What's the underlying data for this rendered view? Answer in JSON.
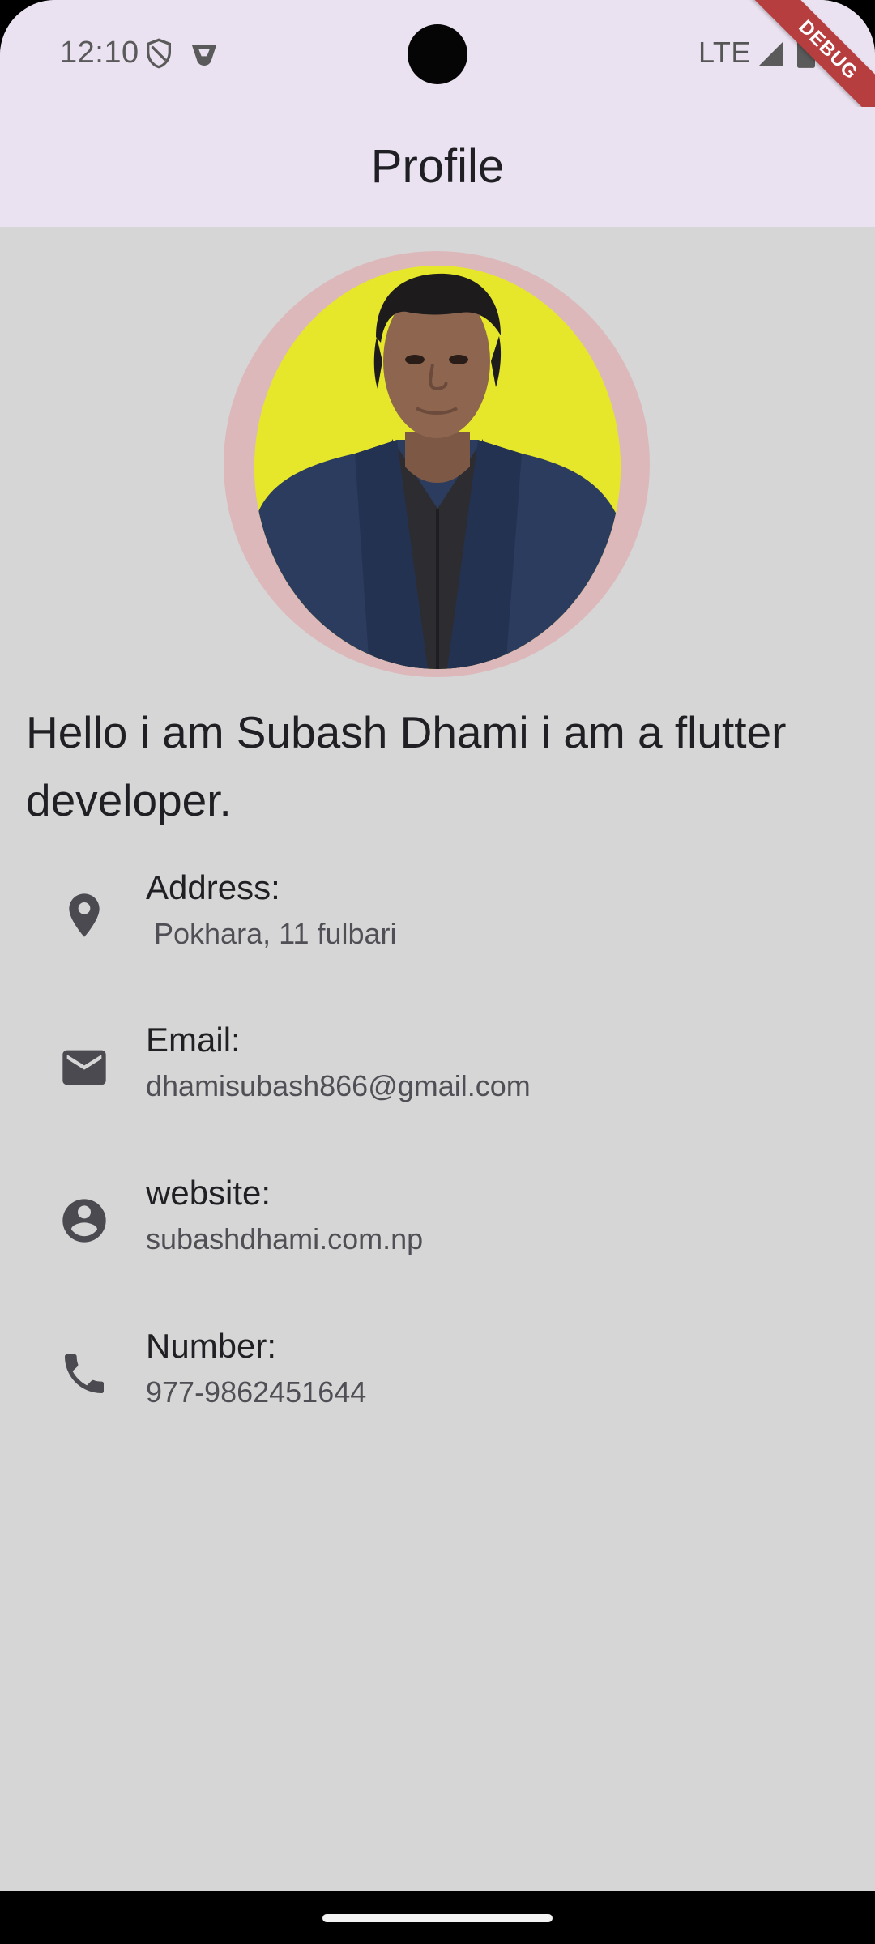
{
  "status_bar": {
    "time": "12:10",
    "network": "LTE",
    "left_icons": [
      "shield-icon",
      "vpn-key-icon"
    ],
    "right_icons": [
      "signal-icon",
      "battery-icon"
    ]
  },
  "debug_banner": "DEBUG",
  "app_bar": {
    "title": "Profile",
    "background": "#ebe2f1"
  },
  "profile": {
    "intro": "Hello i am Subash Dhami i am a flutter developer.",
    "details": [
      {
        "icon": "location-pin-icon",
        "label": "Address:",
        "value": " Pokhara, 11 fulbari"
      },
      {
        "icon": "mail-icon",
        "label": "Email:",
        "value": "dhamisubash866@gmail.com"
      },
      {
        "icon": "account-circle-icon",
        "label": "website:",
        "value": "subashdhami.com.np"
      },
      {
        "icon": "phone-icon",
        "label": "Number:",
        "value": "977-9862451644"
      }
    ]
  },
  "colors": {
    "page_background": "#d6d6d6",
    "avatar_ring": "#ddb8bb",
    "avatar_background": "#e6e72a",
    "icon_color": "#4a4a50",
    "debug_banner": "#b73e3e"
  }
}
